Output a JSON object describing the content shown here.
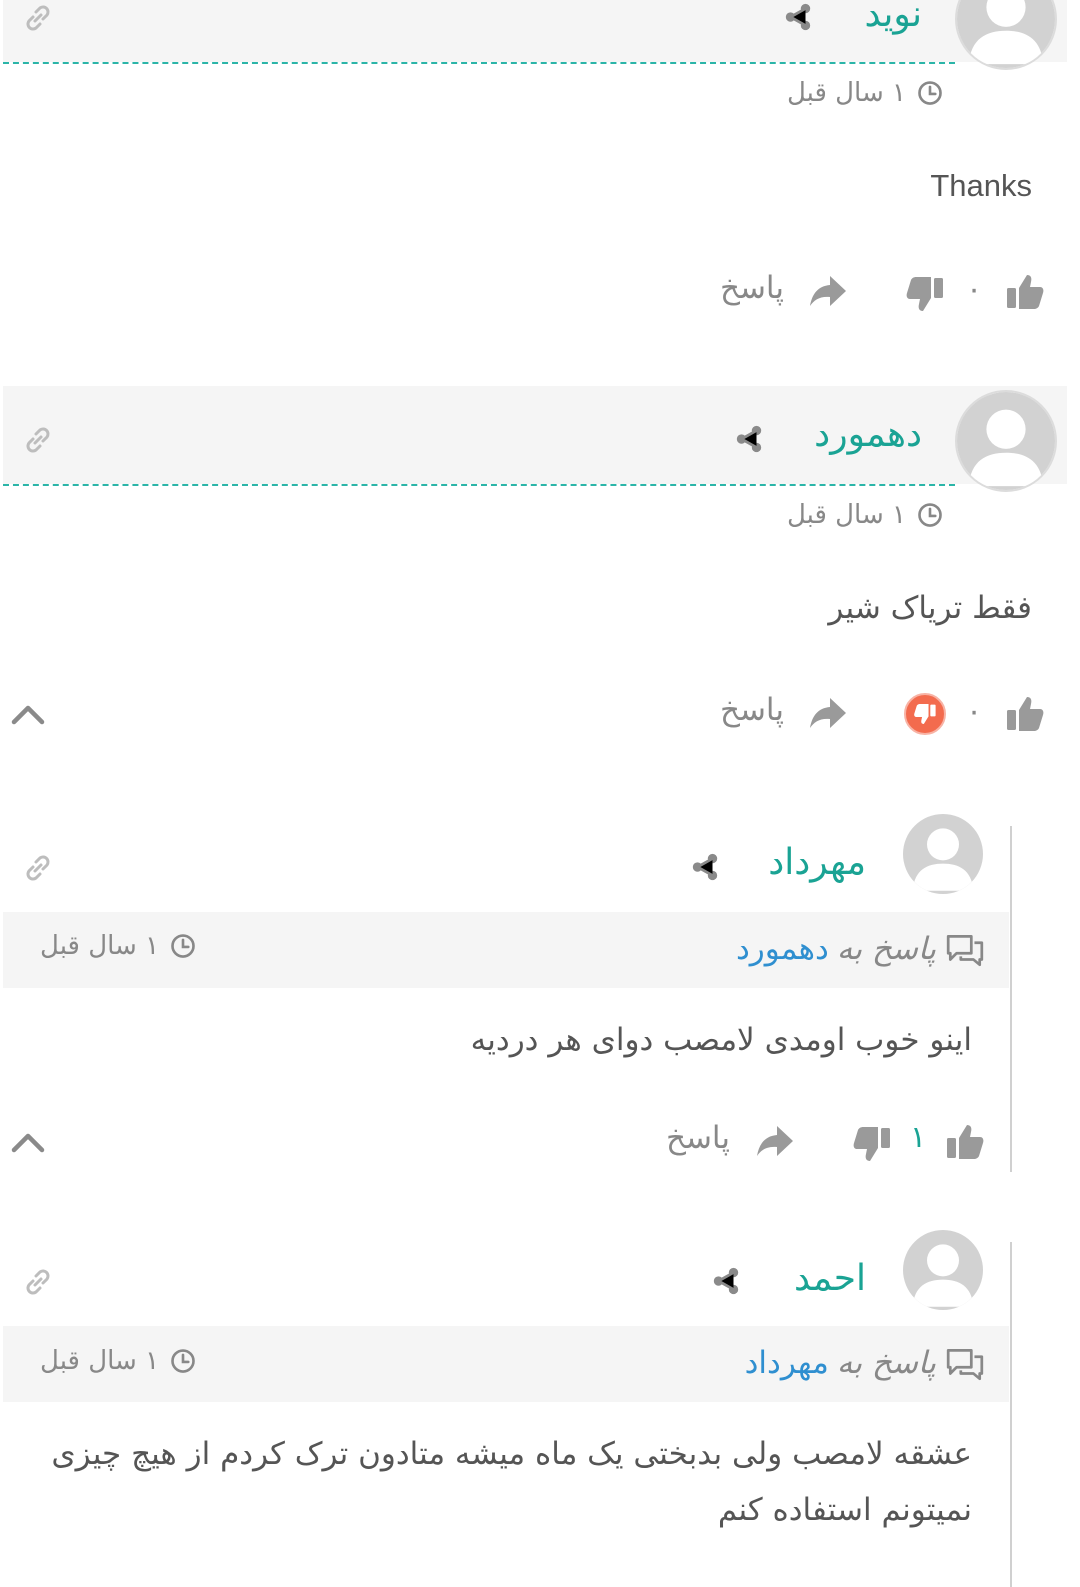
{
  "comments": [
    {
      "author": "نوید",
      "time": "۱ سال قبل",
      "text": "Thanks",
      "likes": "۰",
      "reply_label": "پاسخ"
    },
    {
      "author": "دهمورد",
      "time": "۱ سال قبل",
      "text": "فقط تریاک شیر",
      "likes": "۰",
      "reply_label": "پاسخ"
    },
    {
      "author": "مهرداد",
      "reply_prefix": "پاسخ به",
      "reply_to": "دهمورد",
      "time": "۱ سال قبل",
      "text": "اینو خوب اومدی لامصب دوای هر دردیه",
      "likes": "۱",
      "reply_label": "پاسخ"
    },
    {
      "author": "احمد",
      "reply_prefix": "پاسخ به",
      "reply_to": "مهرداد",
      "time": "۱ سال قبل",
      "text": "عشقه لامصب ولی بدبختی یک ماه میشه متادون ترک کردم از هیچ چیزی نمیتونم استفاده کنم"
    }
  ],
  "colors": {
    "author": "#1aa394",
    "reply_to": "#2f8fd0",
    "muted": "#888888",
    "header_bg": "#f5f5f5",
    "dash": "#2bb5a8",
    "dislike_active": "#f36b4e"
  },
  "icons": [
    "link-icon",
    "share-icon",
    "clock-icon",
    "thumbs-up-icon",
    "thumbs-down-icon",
    "reply-arrow-icon",
    "chevron-up-icon",
    "comments-icon",
    "avatar-icon"
  ]
}
